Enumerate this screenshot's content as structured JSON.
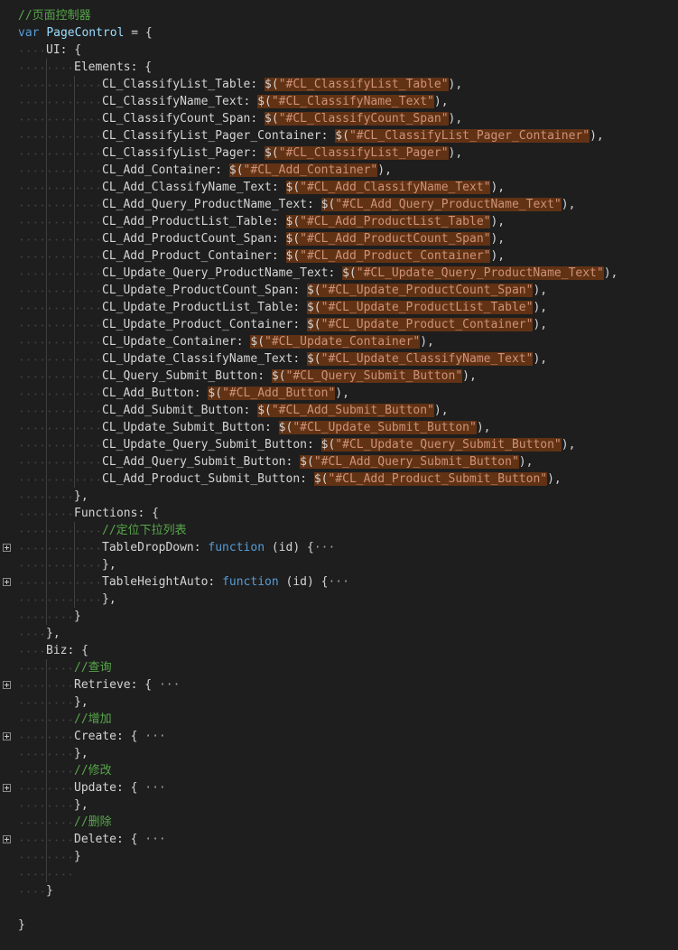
{
  "colors": {
    "background": "#1e1e1e",
    "keyword": "#569cd6",
    "string": "#ce9178",
    "comment": "#57a64a",
    "highlight": "#613214",
    "default": "#d4d4d4"
  },
  "code": {
    "comment_title": "//页面控制器",
    "var_kw": "var",
    "var_name": "PageControl",
    "assign_open": " = {",
    "ui_key": "UI:",
    "elements_key": "Elements:",
    "open_brace": " {",
    "elements": [
      {
        "key": "CL_ClassifyList_Table",
        "selector": "\"#CL_ClassifyList_Table\""
      },
      {
        "key": "CL_ClassifyName_Text",
        "selector": "\"#CL_ClassifyName_Text\""
      },
      {
        "key": "CL_ClassifyCount_Span",
        "selector": "\"#CL_ClassifyCount_Span\""
      },
      {
        "key": "CL_ClassifyList_Pager_Container",
        "selector": "\"#CL_ClassifyList_Pager_Container\""
      },
      {
        "key": "CL_ClassifyList_Pager",
        "selector": "\"#CL_ClassifyList_Pager\""
      },
      {
        "key": "CL_Add_Container",
        "selector": "\"#CL_Add_Container\""
      },
      {
        "key": "CL_Add_ClassifyName_Text",
        "selector": "\"#CL_Add_ClassifyName_Text\""
      },
      {
        "key": "CL_Add_Query_ProductName_Text",
        "selector": "\"#CL_Add_Query_ProductName_Text\""
      },
      {
        "key": "CL_Add_ProductList_Table",
        "selector": "\"#CL_Add_ProductList_Table\""
      },
      {
        "key": "CL_Add_ProductCount_Span",
        "selector": "\"#CL_Add_ProductCount_Span\""
      },
      {
        "key": "CL_Add_Product_Container",
        "selector": "\"#CL_Add_Product_Container\""
      },
      {
        "key": "CL_Update_Query_ProductName_Text",
        "selector": "\"#CL_Update_Query_ProductName_Text\""
      },
      {
        "key": "CL_Update_ProductCount_Span",
        "selector": "\"#CL_Update_ProductCount_Span\""
      },
      {
        "key": "CL_Update_ProductList_Table",
        "selector": "\"#CL_Update_ProductList_Table\""
      },
      {
        "key": "CL_Update_Product_Container",
        "selector": "\"#CL_Update_Product_Container\""
      },
      {
        "key": "CL_Update_Container",
        "selector": "\"#CL_Update_Container\""
      },
      {
        "key": "CL_Update_ClassifyName_Text",
        "selector": "\"#CL_Update_ClassifyName_Text\""
      },
      {
        "key": "CL_Query_Submit_Button",
        "selector": "\"#CL_Query_Submit_Button\""
      },
      {
        "key": "CL_Add_Button",
        "selector": "\"#CL_Add_Button\""
      },
      {
        "key": "CL_Add_Submit_Button",
        "selector": "\"#CL_Add_Submit_Button\""
      },
      {
        "key": "CL_Update_Submit_Button",
        "selector": "\"#CL_Update_Submit_Button\""
      },
      {
        "key": "CL_Update_Query_Submit_Button",
        "selector": "\"#CL_Update_Query_Submit_Button\""
      },
      {
        "key": "CL_Add_Query_Submit_Button",
        "selector": "\"#CL_Add_Query_Submit_Button\""
      },
      {
        "key": "CL_Add_Product_Submit_Button",
        "selector": "\"#CL_Add_Product_Submit_Button\""
      }
    ],
    "close_comma": "},",
    "close": "}",
    "functions_key": "Functions:",
    "comment_dropdown": "//定位下拉列表",
    "table_dropdown_key": "TableDropDown:",
    "table_height_key": "TableHeightAuto:",
    "function_kw": "function",
    "fn_params": " (id) {",
    "ellipsis": "···",
    "biz_key": "Biz:",
    "comment_retrieve": "//查询",
    "retrieve_key": "Retrieve:",
    "comment_create": "//增加",
    "create_key": "Create:",
    "comment_update": "//修改",
    "update_key": "Update:",
    "comment_delete": "//删除",
    "delete_key": "Delete:"
  }
}
